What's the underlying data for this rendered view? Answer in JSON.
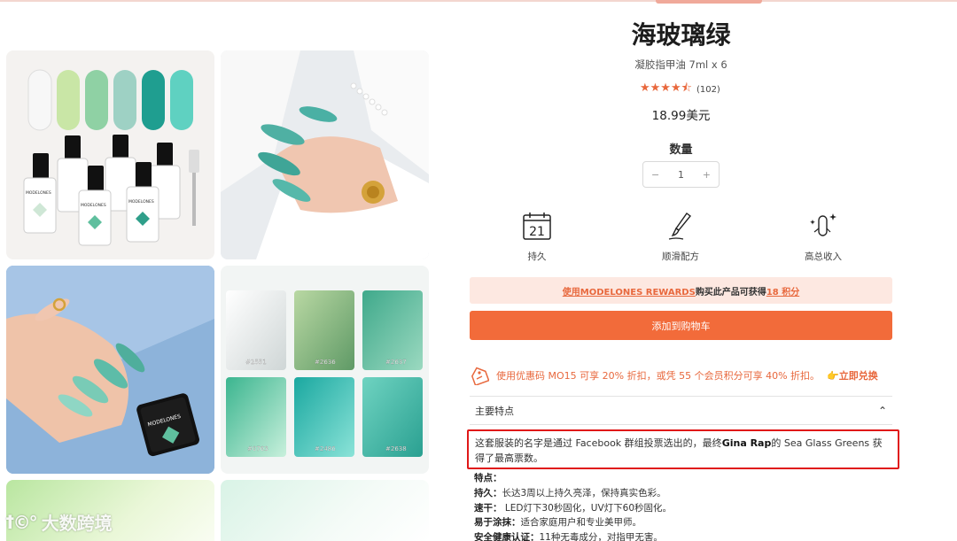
{
  "product": {
    "title": "海玻璃绿",
    "subtitle": "凝胶指甲油 7ml x 6",
    "stars": "★★★★⯪",
    "reviews": "(102)",
    "price": "18.99美元",
    "quantity_label": "数量",
    "quantity": "1",
    "minus": "−",
    "plus": "+"
  },
  "features": [
    {
      "label": "持久",
      "icon": "calendar-icon",
      "day": "21"
    },
    {
      "label": "顺滑配方",
      "icon": "brush-icon"
    },
    {
      "label": "高总收入",
      "icon": "sparkle-nail-icon"
    }
  ],
  "rewards": {
    "link": "使用MODELONES REWARDS",
    "middle": "购买此产品可获得",
    "points": "18 积分"
  },
  "cart_button": "添加到购物车",
  "promo": {
    "text": "使用优惠码 MO15 可享 20% 折扣，或凭 55 个会员积分可享 40% 折扣。",
    "redeem": "👉立即兑换"
  },
  "accordion": {
    "title": "主要特点",
    "chevron": "⌃"
  },
  "description": {
    "part1": "这套服装的名字是通过 Facebook 群组投票选出的，最终",
    "name": "Gina Rap",
    "part2": "的 Sea Glass Greens 获得了最高票数。"
  },
  "feature_list": [
    {
      "key": "特点：",
      "value": ""
    },
    {
      "key": "持久：",
      "value": "长达3周以上持久亮泽，保持真实色彩。"
    },
    {
      "key": "速干：",
      "value": " LED灯下30秒固化，UV灯下60秒固化。"
    },
    {
      "key": "易于涂抹：",
      "value": "适合家庭用户和专业美甲师。"
    },
    {
      "key": "安全健康认证：",
      "value": "11种无毒成分，对指甲无害。"
    }
  ],
  "gallery": {
    "bottle_brand": "MODELONES",
    "swatch_codes": [
      "#2551",
      "#2636",
      "#2637",
      "#0763",
      "#2486",
      "#2638"
    ]
  },
  "watermark": {
    "logo": "ꝉ©°",
    "text": "大数跨境"
  },
  "colors": {
    "accent": "#f26b3a",
    "rewards_bg": "#fde8e1",
    "highlight_border": "#e01818",
    "nail_green": "#3fb3a0"
  }
}
